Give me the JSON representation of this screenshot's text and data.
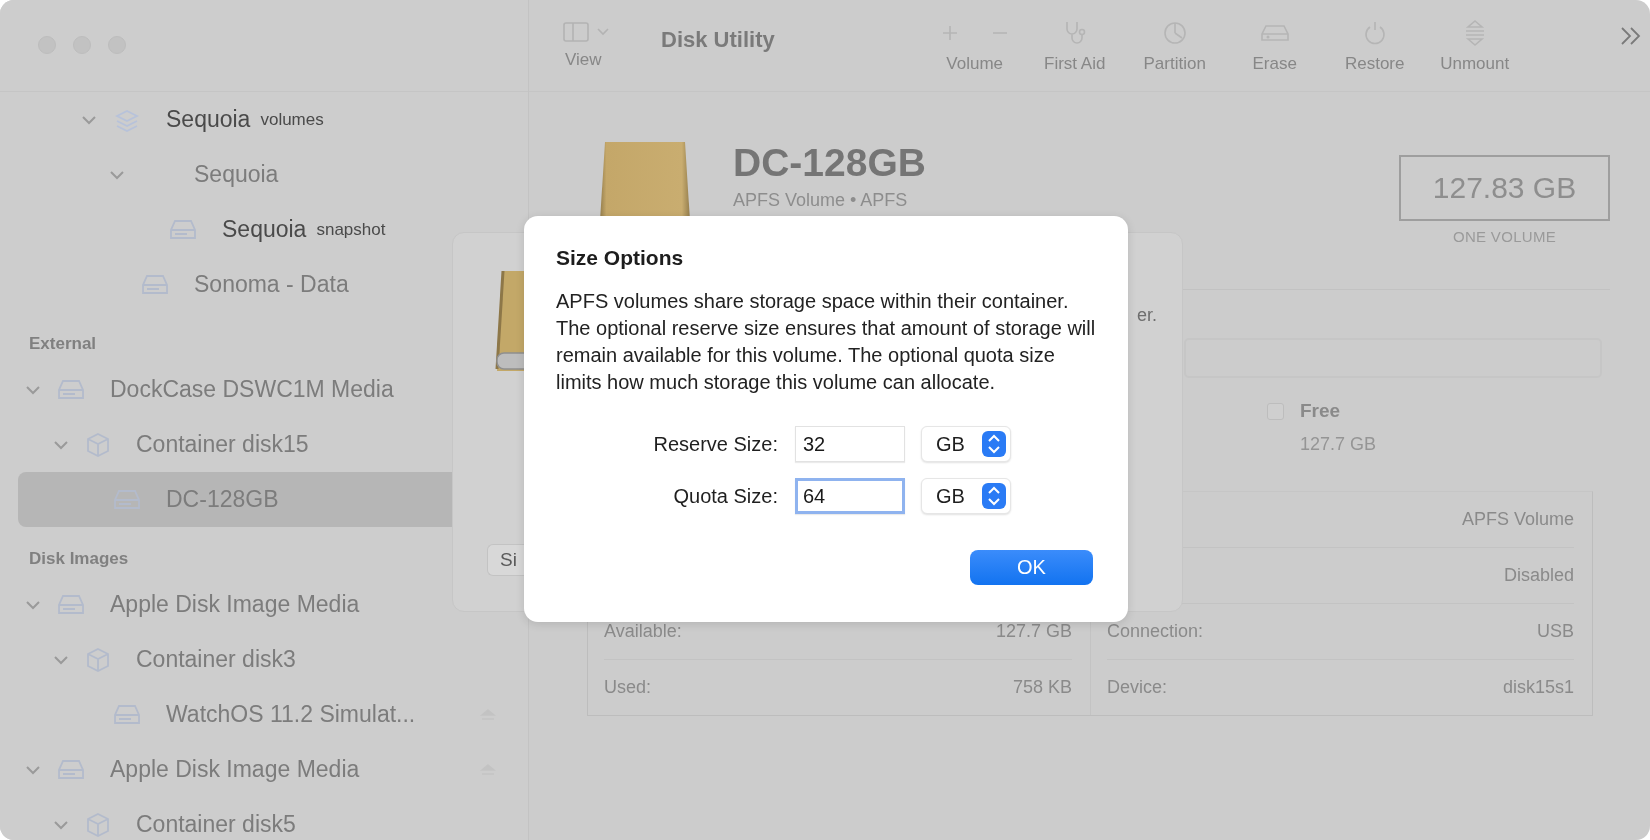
{
  "window": {
    "title": "Disk Utility"
  },
  "toolbar": {
    "view": {
      "label": "View"
    },
    "buttons": [
      {
        "kind": "volume",
        "label": "Volume",
        "disabled": true
      },
      {
        "kind": "first-aid",
        "label": "First Aid",
        "disabled": true
      },
      {
        "kind": "partition",
        "label": "Partition",
        "disabled": true
      },
      {
        "kind": "erase",
        "label": "Erase",
        "disabled": true
      },
      {
        "kind": "restore",
        "label": "Restore",
        "disabled": true
      },
      {
        "kind": "unmount",
        "label": "Unmount",
        "disabled": true
      }
    ]
  },
  "sidebar": {
    "sections": [
      {
        "items": [
          {
            "kind": "volumes",
            "name": "Sequoia",
            "note": "volumes",
            "greyed": false,
            "selected": false,
            "eject": false,
            "expanded": true,
            "children": [
              {
                "kind": "blank",
                "name": "Sequoia",
                "greyed": true,
                "selected": false,
                "eject": false,
                "expanded": true,
                "children": [
                  {
                    "kind": "disk",
                    "name": "Sequoia",
                    "note": "snapshot",
                    "greyed": false,
                    "selected": false,
                    "eject": false
                  }
                ]
              },
              {
                "kind": "disk",
                "name": "Sonoma - Data",
                "greyed": true,
                "selected": false,
                "eject": false
              }
            ]
          }
        ]
      },
      {
        "title": "External",
        "items": [
          {
            "kind": "disk",
            "name": "DockCase DSWC1M Media",
            "greyed": true,
            "selected": false,
            "eject": false,
            "expanded": true,
            "children": [
              {
                "kind": "container",
                "name": "Container disk15",
                "greyed": true,
                "selected": false,
                "eject": false,
                "expanded": true,
                "children": [
                  {
                    "kind": "disk",
                    "name": "DC-128GB",
                    "greyed": true,
                    "selected": true,
                    "eject": false
                  }
                ]
              }
            ]
          }
        ]
      },
      {
        "title": "Disk Images",
        "items": [
          {
            "kind": "disk",
            "name": "Apple Disk Image Media",
            "greyed": true,
            "selected": false,
            "eject": false,
            "expanded": true,
            "children": [
              {
                "kind": "container",
                "name": "Container disk3",
                "greyed": true,
                "selected": false,
                "eject": false,
                "expanded": true,
                "children": [
                  {
                    "kind": "disk",
                    "name": "WatchOS 11.2 Simulat...",
                    "greyed": true,
                    "selected": false,
                    "eject": true
                  }
                ]
              }
            ]
          },
          {
            "kind": "disk",
            "name": "Apple Disk Image Media",
            "greyed": true,
            "selected": false,
            "eject": true,
            "expanded": true,
            "children": [
              {
                "kind": "container",
                "name": "Container disk5",
                "greyed": true,
                "selected": false,
                "eject": false,
                "expanded": true
              }
            ]
          }
        ]
      }
    ]
  },
  "volume": {
    "name": "DC-128GB",
    "subtitle": "APFS Volume • APFS",
    "capacity": "127.83 GB",
    "capacity_note": "ONE VOLUME"
  },
  "usage": {
    "legend": [
      {
        "label": "Free",
        "value": "127.7 GB"
      }
    ]
  },
  "info_table": {
    "rows": [
      {
        "right_value": "APFS Volume"
      },
      {
        "right_value": "Disabled"
      },
      {
        "left_label": "Available:",
        "left_value": "127.7 GB",
        "right_label": "Connection:",
        "right_value": "USB"
      },
      {
        "left_label": "Used:",
        "left_value": "758 KB",
        "right_label": "Device:",
        "right_value": "disk15s1"
      }
    ]
  },
  "background_sheet": {
    "text": "er.",
    "button": "Si"
  },
  "dialog": {
    "title": "Size Options",
    "message": "APFS volumes share storage space within their container. The optional reserve size ensures that amount of storage will remain available for this volume. The optional quota size limits how much storage this volume can allocate.",
    "fields": [
      {
        "label": "Reserve Size:",
        "value": "32",
        "unit": "GB",
        "focused": false
      },
      {
        "label": "Quota Size:",
        "value": "64",
        "unit": "GB",
        "focused": true
      }
    ],
    "buttons": [
      {
        "label": "OK",
        "default": true
      }
    ]
  }
}
